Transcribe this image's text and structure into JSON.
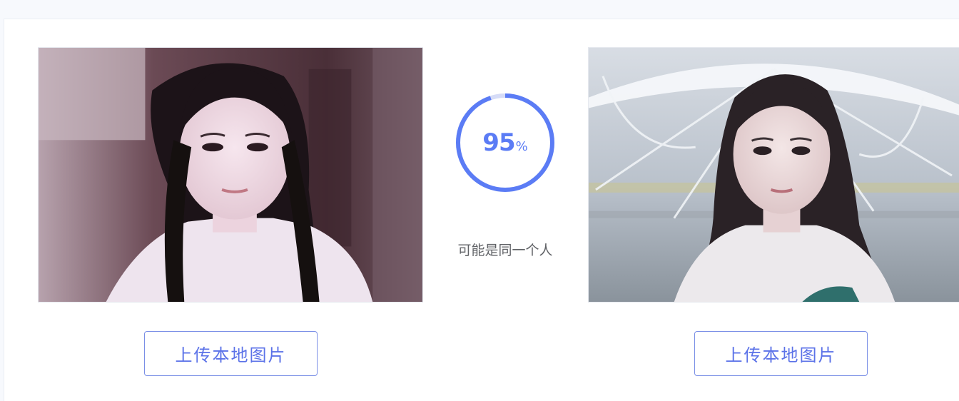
{
  "comparison": {
    "score": "95",
    "percent_sign": "%",
    "score_fraction": 0.95,
    "verdict": "可能是同一个人",
    "ring_color": "#5b7cf5",
    "ring_track_color": "#d6dcf7"
  },
  "left_panel": {
    "upload_label": "上传本地图片"
  },
  "right_panel": {
    "upload_label": "上传本地图片"
  },
  "colors": {
    "accent": "#5b72e8",
    "page_bg": "#f7f9fd"
  }
}
